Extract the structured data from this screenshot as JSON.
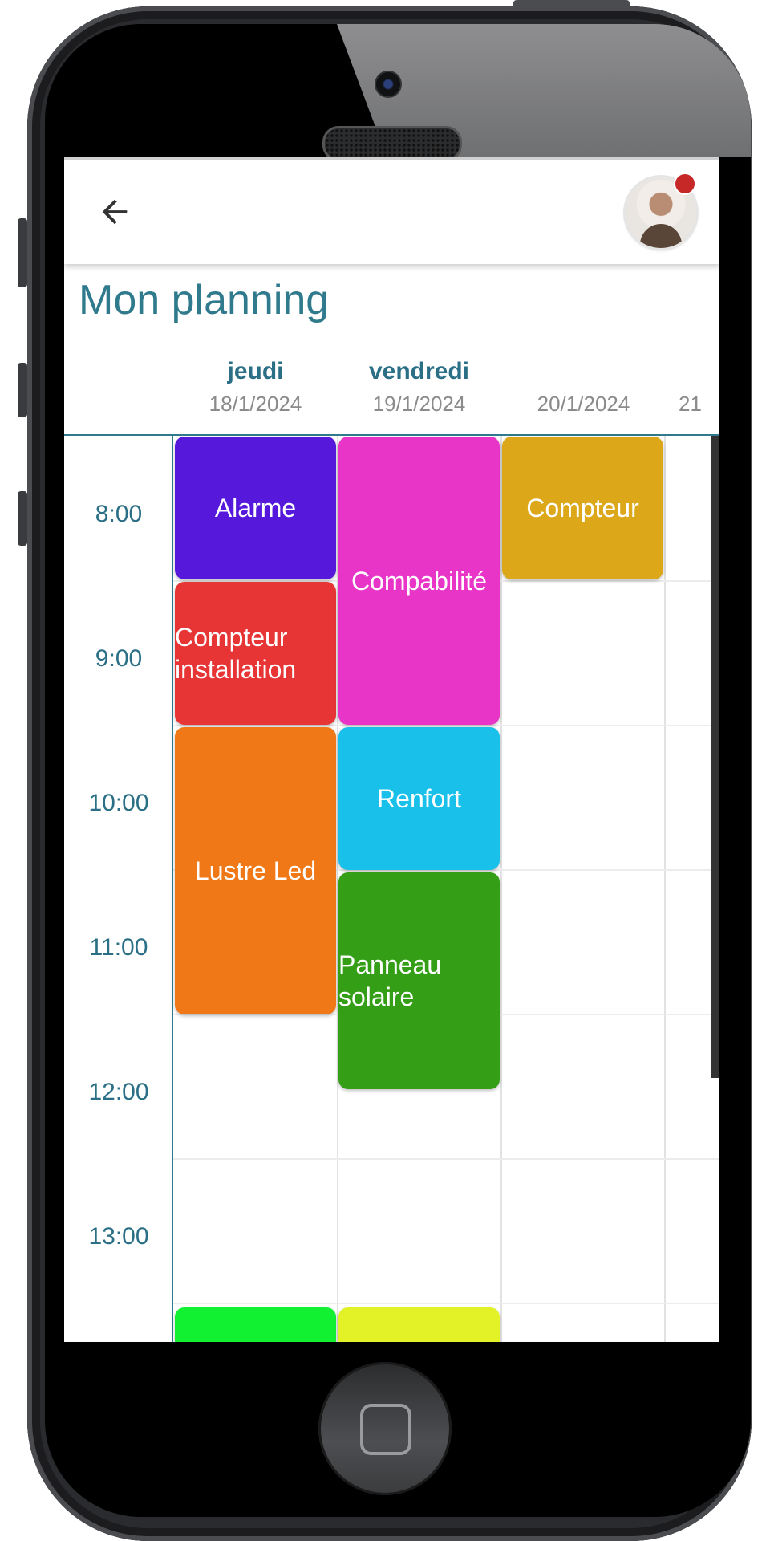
{
  "header": {
    "title": "Mon planning"
  },
  "days": [
    {
      "name": "jeudi",
      "date": "18/1/2024"
    },
    {
      "name": "vendredi",
      "date": "19/1/2024"
    },
    {
      "name": "",
      "date": "20/1/2024"
    },
    {
      "name": "",
      "date": "21"
    }
  ],
  "times": [
    "8:00",
    "9:00",
    "10:00",
    "11:00",
    "12:00",
    "13:00"
  ],
  "events": {
    "alarme": {
      "label": "Alarme",
      "color": "#5619dc"
    },
    "compteur_installation": {
      "label": "Compteur installation",
      "color": "#e73434"
    },
    "lustre_led": {
      "label": "Lustre Led",
      "color": "#f07817"
    },
    "compabilite": {
      "label": "Compabilité",
      "color": "#e835c7"
    },
    "renfort": {
      "label": "Renfort",
      "color": "#19c0ea"
    },
    "panneau_solaire": {
      "label": "Panneau solaire",
      "color": "#339e16"
    },
    "compteur": {
      "label": "Compteur",
      "color": "#dca718"
    },
    "green_event": {
      "label": "",
      "color": "#11f031"
    },
    "yellow_event": {
      "label": "",
      "color": "#e2f227"
    }
  },
  "colors": {
    "accent": "#2f7a8c",
    "notification": "#c62828"
  },
  "icons": {
    "back": "arrow-left-icon",
    "avatar": "user-avatar",
    "notification": "notification-dot"
  }
}
